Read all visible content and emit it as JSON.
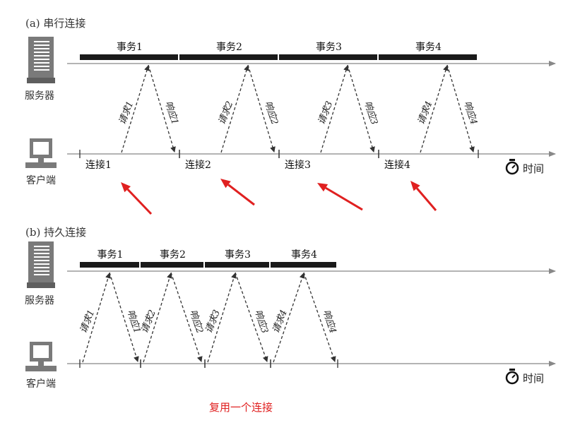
{
  "diagram_a": {
    "title": "(a) 串行连接",
    "server_label": "服务器",
    "client_label": "客户端",
    "transactions": [
      "事务1",
      "事务2",
      "事务3",
      "事务4"
    ],
    "requests": [
      "请求1",
      "请求2",
      "请求3",
      "请求4"
    ],
    "responses": [
      "响应1",
      "响应2",
      "响应3",
      "响应4"
    ],
    "connections": [
      "连接1",
      "连接2",
      "连接3",
      "连接4"
    ],
    "time_label": "时间"
  },
  "diagram_b": {
    "title": "(b) 持久连接",
    "server_label": "服务器",
    "client_label": "客户端",
    "transactions": [
      "事务1",
      "事务2",
      "事务3",
      "事务4"
    ],
    "requests": [
      "请求1",
      "请求2",
      "请求3",
      "请求4"
    ],
    "responses": [
      "响应1",
      "响应2",
      "响应3",
      "响应4"
    ],
    "time_label": "时间"
  },
  "annotation": {
    "text": "复用一个连接",
    "color": "#e02020"
  },
  "colors": {
    "line": "#888888",
    "bar": "#1a1a1a",
    "arrow": "#e02020",
    "icon": "#7a7a7a"
  }
}
